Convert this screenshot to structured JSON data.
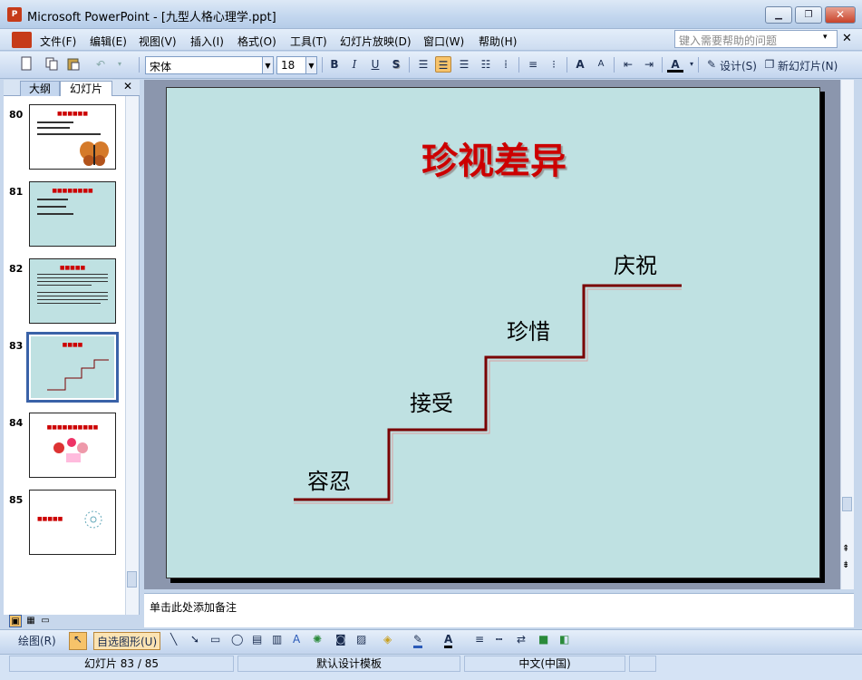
{
  "window": {
    "title": "Microsoft PowerPoint - [九型人格心理学.ppt]",
    "app_icon_text": "P",
    "minimize": "▁",
    "restore": "❐",
    "close": "✕"
  },
  "menu": {
    "items": [
      "文件(F)",
      "编辑(E)",
      "视图(V)",
      "插入(I)",
      "格式(O)",
      "工具(T)",
      "幻灯片放映(D)",
      "窗口(W)",
      "帮助(H)"
    ],
    "help_placeholder": "键入需要帮助的问题",
    "help_arrow": "▾",
    "doc_close": "✕"
  },
  "toolbar": {
    "font_name": "宋体",
    "font_size": "18",
    "bold": "B",
    "italic": "I",
    "underline": "U",
    "shadow": "S",
    "design_label": "设计(S)",
    "new_slide_label": "新幻灯片(N)",
    "font_color_label": "A",
    "grow_font": "A",
    "shrink_font": "A"
  },
  "outline_pane": {
    "tabs": [
      "大纲",
      "幻灯片"
    ],
    "close": "✕",
    "slides": [
      {
        "num": "80",
        "selected": false,
        "bg": "#ffffff"
      },
      {
        "num": "81",
        "selected": false,
        "bg": "#bfe1e2"
      },
      {
        "num": "82",
        "selected": false,
        "bg": "#bfe1e2"
      },
      {
        "num": "83",
        "selected": true,
        "bg": "#bfe1e2"
      },
      {
        "num": "84",
        "selected": false,
        "bg": "#ffffff"
      },
      {
        "num": "85",
        "selected": false,
        "bg": "#ffffff"
      }
    ]
  },
  "slide": {
    "title": "珍视差异",
    "steps": [
      "容忍",
      "接受",
      "珍惜",
      "庆祝"
    ]
  },
  "notes": {
    "placeholder": "单击此处添加备注"
  },
  "drawing": {
    "draw_label": "绘图(R)",
    "autoshape_label": "自选图形(U)"
  },
  "status": {
    "slide_info": "幻灯片 83 / 85",
    "template": "默认设计模板",
    "language": "中文(中国)"
  },
  "colors": {
    "title_red": "#cc0000",
    "slide_bg": "#bfe1e2",
    "stair_dark": "#7a0000",
    "selection": "#3a62a8"
  }
}
